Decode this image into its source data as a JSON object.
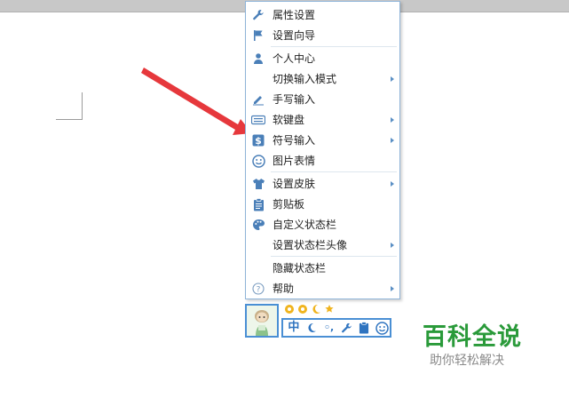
{
  "menu": {
    "items": [
      {
        "label": "属性设置",
        "icon": "wrench-icon",
        "submenu": false
      },
      {
        "label": "设置向导",
        "icon": "flag-icon",
        "submenu": false
      },
      {
        "label": "个人中心",
        "icon": "person-icon",
        "submenu": false
      },
      {
        "label": "切换输入模式",
        "icon": "",
        "submenu": true
      },
      {
        "label": "手写输入",
        "icon": "pencil-icon",
        "submenu": false
      },
      {
        "label": "软键盘",
        "icon": "keyboard-icon",
        "submenu": true
      },
      {
        "label": "符号输入",
        "icon": "dollar-icon",
        "submenu": true
      },
      {
        "label": "图片表情",
        "icon": "smiley-icon",
        "submenu": false
      },
      {
        "label": "设置皮肤",
        "icon": "shirt-icon",
        "submenu": true
      },
      {
        "label": "剪贴板",
        "icon": "clipboard-icon",
        "submenu": false
      },
      {
        "label": "自定义状态栏",
        "icon": "palette-icon",
        "submenu": false
      },
      {
        "label": "设置状态栏头像",
        "icon": "",
        "submenu": true
      },
      {
        "label": "隐藏状态栏",
        "icon": "",
        "submenu": false
      },
      {
        "label": "帮助",
        "icon": "help-icon",
        "submenu": true
      }
    ]
  },
  "status_bar": {
    "mode_label": "中",
    "punct_label": "◦,"
  },
  "watermark": {
    "title": "百科全说",
    "subtitle": "助你轻松解决"
  },
  "colors": {
    "accent": "#4a8fd4",
    "icon": "#4a7fb8",
    "arrow": "#e6383c",
    "brand_green": "#2a9a3a"
  }
}
